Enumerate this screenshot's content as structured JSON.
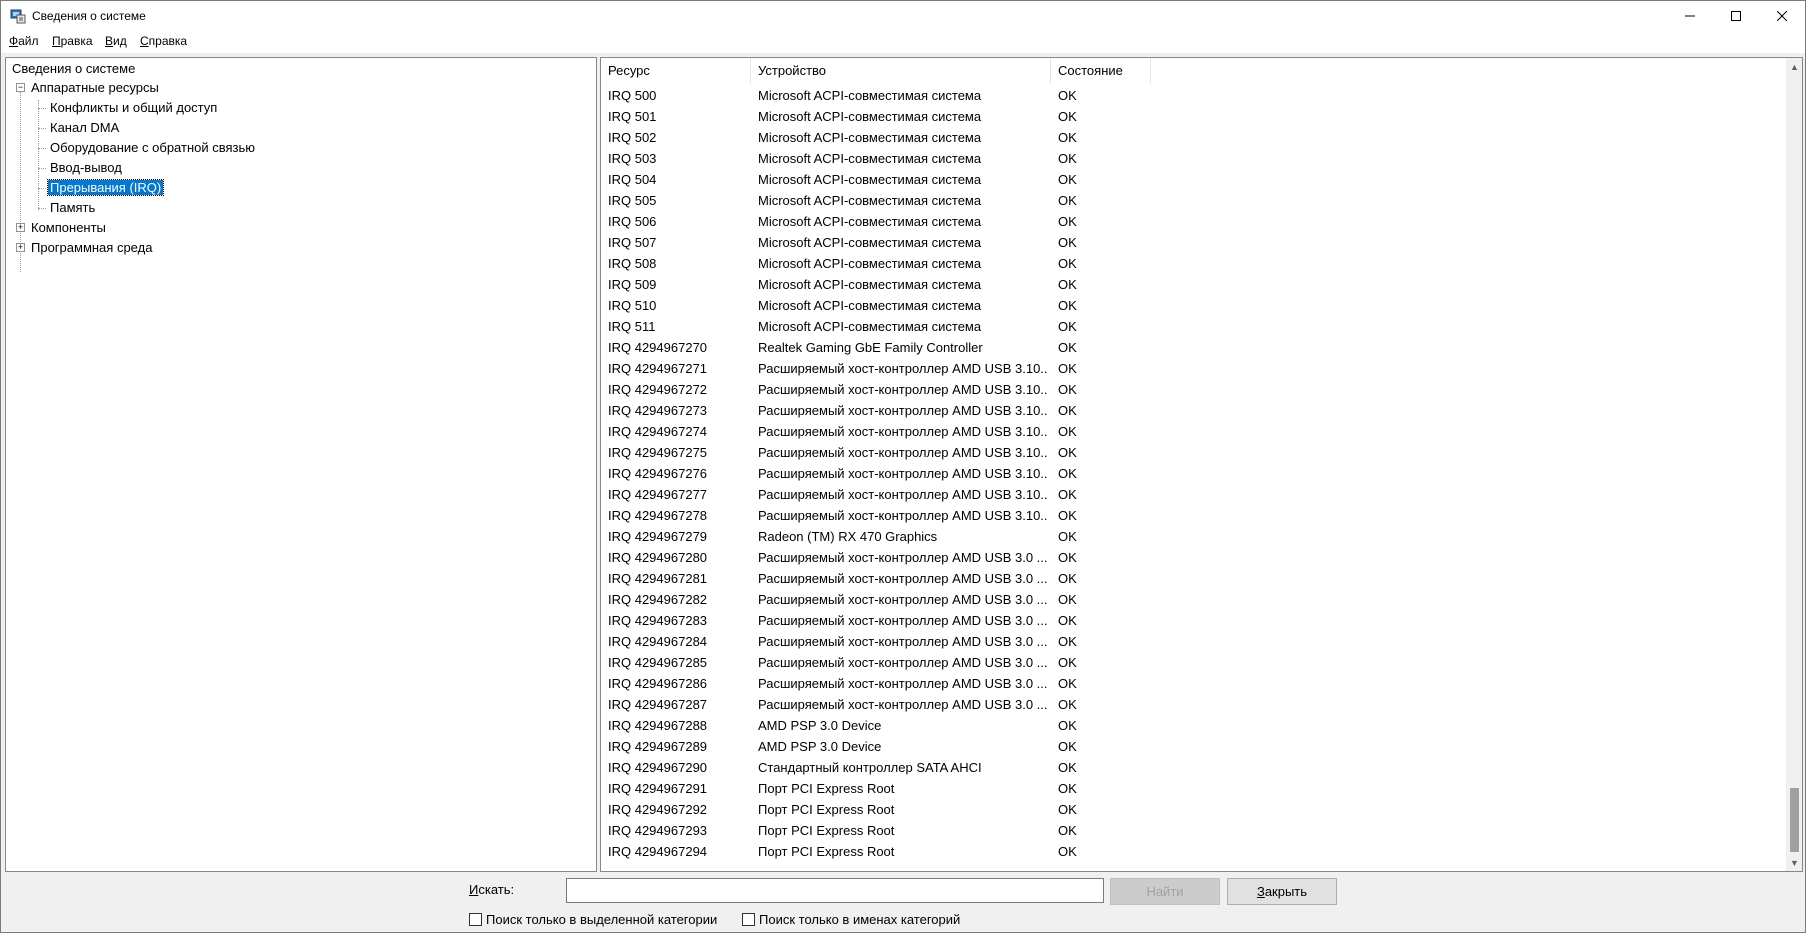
{
  "window": {
    "title": "Сведения о системе"
  },
  "menu": [
    {
      "mnemonic": "Ф",
      "rest": "айл"
    },
    {
      "mnemonic": "П",
      "rest": "равка"
    },
    {
      "mnemonic": "В",
      "rest": "ид"
    },
    {
      "mnemonic": "С",
      "rest": "правка"
    }
  ],
  "tree": {
    "root": "Сведения о системе",
    "hardware": "Аппаратные ресурсы",
    "hardware_children": [
      "Конфликты и общий доступ",
      "Канал DMA",
      "Оборудование с обратной связью",
      "Ввод-вывод",
      "Прерывания (IRQ)",
      "Память"
    ],
    "components": "Компоненты",
    "software": "Программная среда"
  },
  "list": {
    "headers": {
      "resource": "Ресурс",
      "device": "Устройство",
      "state": "Состояние"
    },
    "rows": [
      [
        "IRQ 500",
        "Microsoft ACPI-совместимая система",
        "OK"
      ],
      [
        "IRQ 501",
        "Microsoft ACPI-совместимая система",
        "OK"
      ],
      [
        "IRQ 502",
        "Microsoft ACPI-совместимая система",
        "OK"
      ],
      [
        "IRQ 503",
        "Microsoft ACPI-совместимая система",
        "OK"
      ],
      [
        "IRQ 504",
        "Microsoft ACPI-совместимая система",
        "OK"
      ],
      [
        "IRQ 505",
        "Microsoft ACPI-совместимая система",
        "OK"
      ],
      [
        "IRQ 506",
        "Microsoft ACPI-совместимая система",
        "OK"
      ],
      [
        "IRQ 507",
        "Microsoft ACPI-совместимая система",
        "OK"
      ],
      [
        "IRQ 508",
        "Microsoft ACPI-совместимая система",
        "OK"
      ],
      [
        "IRQ 509",
        "Microsoft ACPI-совместимая система",
        "OK"
      ],
      [
        "IRQ 510",
        "Microsoft ACPI-совместимая система",
        "OK"
      ],
      [
        "IRQ 511",
        "Microsoft ACPI-совместимая система",
        "OK"
      ],
      [
        "IRQ 4294967270",
        "Realtek Gaming GbE Family Controller",
        "OK"
      ],
      [
        "IRQ 4294967271",
        "Расширяемый хост-контроллер AMD USB 3.10...",
        "OK"
      ],
      [
        "IRQ 4294967272",
        "Расширяемый хост-контроллер AMD USB 3.10...",
        "OK"
      ],
      [
        "IRQ 4294967273",
        "Расширяемый хост-контроллер AMD USB 3.10...",
        "OK"
      ],
      [
        "IRQ 4294967274",
        "Расширяемый хост-контроллер AMD USB 3.10...",
        "OK"
      ],
      [
        "IRQ 4294967275",
        "Расширяемый хост-контроллер AMD USB 3.10...",
        "OK"
      ],
      [
        "IRQ 4294967276",
        "Расширяемый хост-контроллер AMD USB 3.10...",
        "OK"
      ],
      [
        "IRQ 4294967277",
        "Расширяемый хост-контроллер AMD USB 3.10...",
        "OK"
      ],
      [
        "IRQ 4294967278",
        "Расширяемый хост-контроллер AMD USB 3.10...",
        "OK"
      ],
      [
        "IRQ 4294967279",
        "Radeon (TM) RX 470 Graphics",
        "OK"
      ],
      [
        "IRQ 4294967280",
        "Расширяемый хост-контроллер AMD USB 3.0 ...",
        "OK"
      ],
      [
        "IRQ 4294967281",
        "Расширяемый хост-контроллер AMD USB 3.0 ...",
        "OK"
      ],
      [
        "IRQ 4294967282",
        "Расширяемый хост-контроллер AMD USB 3.0 ...",
        "OK"
      ],
      [
        "IRQ 4294967283",
        "Расширяемый хост-контроллер AMD USB 3.0 ...",
        "OK"
      ],
      [
        "IRQ 4294967284",
        "Расширяемый хост-контроллер AMD USB 3.0 ...",
        "OK"
      ],
      [
        "IRQ 4294967285",
        "Расширяемый хост-контроллер AMD USB 3.0 ...",
        "OK"
      ],
      [
        "IRQ 4294967286",
        "Расширяемый хост-контроллер AMD USB 3.0 ...",
        "OK"
      ],
      [
        "IRQ 4294967287",
        "Расширяемый хост-контроллер AMD USB 3.0 ...",
        "OK"
      ],
      [
        "IRQ 4294967288",
        "AMD PSP 3.0 Device",
        "OK"
      ],
      [
        "IRQ 4294967289",
        "AMD PSP 3.0 Device",
        "OK"
      ],
      [
        "IRQ 4294967290",
        "Стандартный контроллер SATA AHCI",
        "OK"
      ],
      [
        "IRQ 4294967291",
        "Порт PCI Express Root",
        "OK"
      ],
      [
        "IRQ 4294967292",
        "Порт PCI Express Root",
        "OK"
      ],
      [
        "IRQ 4294967293",
        "Порт PCI Express Root",
        "OK"
      ],
      [
        "IRQ 4294967294",
        "Порт PCI Express Root",
        "OK"
      ]
    ]
  },
  "search": {
    "label_mnemonic": "И",
    "label_rest": "скать:",
    "value": "",
    "find_button": "Найти",
    "close_mnemonic": "З",
    "close_rest": "акрыть",
    "check1": "Поиск только в выделенной категории",
    "check2": "Поиск только в именах категорий"
  }
}
